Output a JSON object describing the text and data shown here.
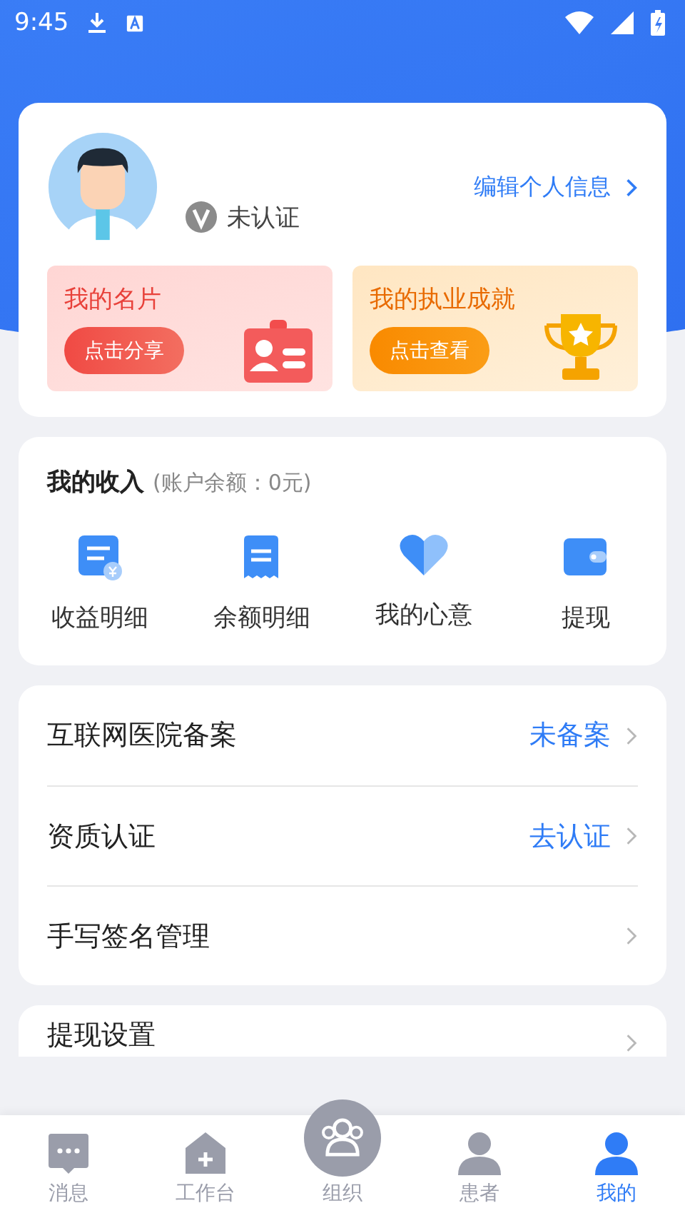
{
  "status_bar": {
    "time": "9:45"
  },
  "profile": {
    "verification": "未认证",
    "edit_link": "编辑个人信息",
    "cards": [
      {
        "kind": "card",
        "title": "我的名片",
        "button": "点击分享"
      },
      {
        "kind": "trophy",
        "title": "我的执业成就",
        "button": "点击查看"
      }
    ]
  },
  "income": {
    "title": "我的收入",
    "balance": "(账户余额：0元)",
    "items": [
      {
        "kind": "bill",
        "label": "收益明细"
      },
      {
        "kind": "receipt",
        "label": "余额明细"
      },
      {
        "kind": "heart",
        "label": "我的心意"
      },
      {
        "kind": "wallet",
        "label": "提现"
      }
    ]
  },
  "settings": [
    {
      "label": "互联网医院备案",
      "status": "未备案"
    },
    {
      "label": "资质认证",
      "status": "去认证"
    },
    {
      "label": "手写签名管理"
    }
  ],
  "more_settings": [
    {
      "label": "提现设置"
    }
  ],
  "bottom_nav": [
    {
      "kind": "chat",
      "label": "消息",
      "selected": false
    },
    {
      "kind": "workbench",
      "label": "工作台",
      "selected": false
    },
    {
      "kind": "group",
      "label": "组织",
      "selected": false
    },
    {
      "kind": "patient",
      "label": "患者",
      "selected": false
    },
    {
      "kind": "me",
      "label": "我的",
      "selected": true
    }
  ]
}
